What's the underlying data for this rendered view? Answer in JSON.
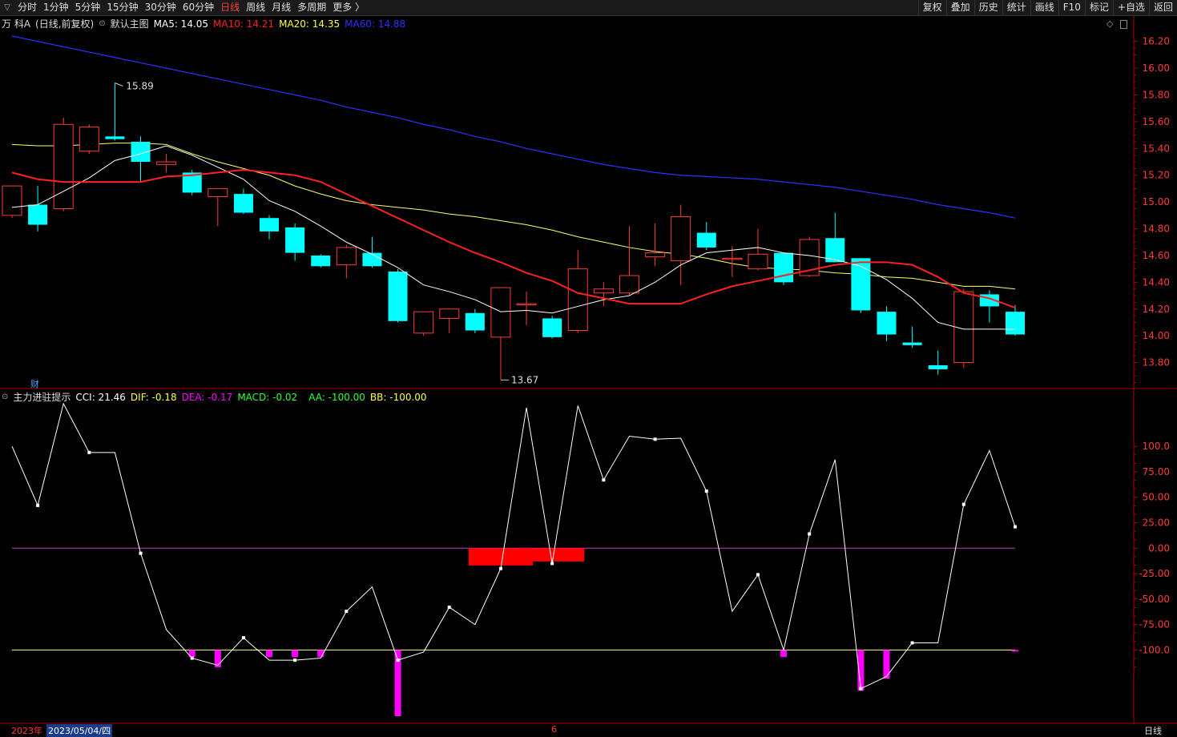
{
  "toolbar": {
    "tabs": [
      "分时",
      "1分钟",
      "5分钟",
      "15分钟",
      "30分钟",
      "60分钟",
      "日线",
      "周线",
      "月线",
      "多周期",
      "更多 〉"
    ],
    "active_tab": "日线",
    "right_buttons": [
      "复权",
      "叠加",
      "历史",
      "统计",
      "画线",
      "F10",
      "标记",
      "+自选",
      "返回"
    ]
  },
  "main": {
    "stock_name": "万 科A",
    "period": "(日线,前复权)",
    "chart_label": "默认主图",
    "ma5": "MA5: 14.05",
    "ma10": "MA10: 14.21",
    "ma20": "MA20: 14.35",
    "ma60": "MA60: 14.88",
    "high_label": "15.89",
    "low_label": "13.67",
    "cai_label": "财",
    "yticks": [
      "16.20",
      "16.00",
      "15.80",
      "15.60",
      "15.40",
      "15.20",
      "15.00",
      "14.80",
      "14.60",
      "14.40",
      "14.20",
      "14.00",
      "13.80"
    ]
  },
  "indicator": {
    "title": "主力进驻提示",
    "cci": "CCI: 21.46",
    "dif": "DIF: -0.18",
    "dea": "DEA: -0.17",
    "macd": "MACD: -0.02",
    "aa": "AA: -100.00",
    "bb": "BB: -100.00",
    "yticks": [
      "100.0",
      "75.00",
      "50.00",
      "25.00",
      "0.00",
      "-25.00",
      "-50.00",
      "-75.00",
      "-100.0"
    ]
  },
  "bottom": {
    "year": "2023年",
    "date": "2023/05/04/四",
    "month_mark": "6",
    "period_label": "日线"
  },
  "colors": {
    "up": "#ff3b3b",
    "down": "#00ffff",
    "ma5": "#ffffff",
    "ma10": "#ff2020",
    "ma20": "#ffff66",
    "ma60": "#3030ff",
    "axis": "#b00000",
    "magenta": "#ff00ff"
  },
  "chart_data": [
    {
      "type": "candlestick",
      "ylim": [
        13.6,
        16.3
      ],
      "candles": [
        {
          "o": 14.9,
          "h": 15.12,
          "l": 14.88,
          "c": 15.12
        },
        {
          "o": 14.98,
          "h": 15.12,
          "l": 14.78,
          "c": 14.83
        },
        {
          "o": 14.95,
          "h": 15.63,
          "l": 14.93,
          "c": 15.58
        },
        {
          "o": 15.38,
          "h": 15.58,
          "l": 15.36,
          "c": 15.56
        },
        {
          "o": 15.49,
          "h": 15.89,
          "l": 15.46,
          "c": 15.47
        },
        {
          "o": 15.45,
          "h": 15.49,
          "l": 15.15,
          "c": 15.3
        },
        {
          "o": 15.28,
          "h": 15.36,
          "l": 15.22,
          "c": 15.3
        },
        {
          "o": 15.22,
          "h": 15.24,
          "l": 15.05,
          "c": 15.07
        },
        {
          "o": 15.04,
          "h": 15.1,
          "l": 14.82,
          "c": 15.1
        },
        {
          "o": 15.06,
          "h": 15.1,
          "l": 14.91,
          "c": 14.92
        },
        {
          "o": 14.88,
          "h": 14.9,
          "l": 14.72,
          "c": 14.78
        },
        {
          "o": 14.81,
          "h": 14.84,
          "l": 14.56,
          "c": 14.62
        },
        {
          "o": 14.6,
          "h": 14.61,
          "l": 14.51,
          "c": 14.52
        },
        {
          "o": 14.53,
          "h": 14.68,
          "l": 14.43,
          "c": 14.66
        },
        {
          "o": 14.62,
          "h": 14.74,
          "l": 14.51,
          "c": 14.52
        },
        {
          "o": 14.48,
          "h": 14.5,
          "l": 14.1,
          "c": 14.11
        },
        {
          "o": 14.02,
          "h": 14.18,
          "l": 14.0,
          "c": 14.18
        },
        {
          "o": 14.13,
          "h": 14.2,
          "l": 14.02,
          "c": 14.2
        },
        {
          "o": 14.17,
          "h": 14.2,
          "l": 14.02,
          "c": 14.04
        },
        {
          "o": 13.99,
          "h": 14.36,
          "l": 13.67,
          "c": 14.36
        },
        {
          "o": 14.24,
          "h": 14.33,
          "l": 14.08,
          "c": 14.24
        },
        {
          "o": 14.13,
          "h": 14.15,
          "l": 13.98,
          "c": 13.99
        },
        {
          "o": 14.04,
          "h": 14.64,
          "l": 14.02,
          "c": 14.5
        },
        {
          "o": 14.32,
          "h": 14.4,
          "l": 14.22,
          "c": 14.35
        },
        {
          "o": 14.32,
          "h": 14.82,
          "l": 14.3,
          "c": 14.45
        },
        {
          "o": 14.59,
          "h": 14.84,
          "l": 14.52,
          "c": 14.62
        },
        {
          "o": 14.56,
          "h": 14.98,
          "l": 14.38,
          "c": 14.89
        },
        {
          "o": 14.77,
          "h": 14.85,
          "l": 14.64,
          "c": 14.66
        },
        {
          "o": 14.58,
          "h": 14.67,
          "l": 14.44,
          "c": 14.58
        },
        {
          "o": 14.5,
          "h": 14.8,
          "l": 14.49,
          "c": 14.61
        },
        {
          "o": 14.62,
          "h": 14.62,
          "l": 14.38,
          "c": 14.4
        },
        {
          "o": 14.45,
          "h": 14.74,
          "l": 14.44,
          "c": 14.72
        },
        {
          "o": 14.73,
          "h": 14.92,
          "l": 14.55,
          "c": 14.55
        },
        {
          "o": 14.58,
          "h": 14.58,
          "l": 14.17,
          "c": 14.19
        },
        {
          "o": 14.18,
          "h": 14.22,
          "l": 13.96,
          "c": 14.01
        },
        {
          "o": 13.95,
          "h": 14.07,
          "l": 13.91,
          "c": 13.93
        },
        {
          "o": 13.78,
          "h": 13.89,
          "l": 13.71,
          "c": 13.75
        },
        {
          "o": 13.8,
          "h": 14.35,
          "l": 13.76,
          "c": 14.33
        },
        {
          "o": 14.31,
          "h": 14.34,
          "l": 14.1,
          "c": 14.22
        },
        {
          "o": 14.18,
          "h": 14.23,
          "l": 14.0,
          "c": 14.01
        }
      ],
      "ma5": [
        14.96,
        14.98,
        15.08,
        15.18,
        15.31,
        15.36,
        15.42,
        15.35,
        15.26,
        15.17,
        15.01,
        14.93,
        14.82,
        14.7,
        14.61,
        14.51,
        14.38,
        14.33,
        14.27,
        14.18,
        14.19,
        14.17,
        14.22,
        14.27,
        14.3,
        14.4,
        14.53,
        14.62,
        14.64,
        14.66,
        14.62,
        14.6,
        14.57,
        14.52,
        14.42,
        14.28,
        14.1,
        14.05,
        14.05,
        14.05
      ],
      "ma10": [
        15.22,
        15.17,
        15.15,
        15.15,
        15.15,
        15.15,
        15.19,
        15.2,
        15.22,
        15.24,
        15.22,
        15.2,
        15.15,
        15.06,
        14.97,
        14.88,
        14.79,
        14.7,
        14.62,
        14.55,
        14.47,
        14.41,
        14.32,
        14.28,
        14.24,
        14.24,
        14.24,
        14.31,
        14.37,
        14.41,
        14.45,
        14.49,
        14.53,
        14.55,
        14.55,
        14.53,
        14.44,
        14.32,
        14.28,
        14.21
      ],
      "ma20": [
        15.43,
        15.42,
        15.42,
        15.43,
        15.44,
        15.44,
        15.43,
        15.36,
        15.3,
        15.25,
        15.2,
        15.12,
        15.06,
        15.01,
        14.98,
        14.96,
        14.94,
        14.91,
        14.89,
        14.86,
        14.83,
        14.79,
        14.74,
        14.7,
        14.66,
        14.63,
        14.61,
        14.58,
        14.54,
        14.51,
        14.5,
        14.49,
        14.47,
        14.46,
        14.44,
        14.43,
        14.4,
        14.37,
        14.37,
        14.35
      ],
      "ma60": [
        16.24,
        16.2,
        16.16,
        16.12,
        16.08,
        16.04,
        16.0,
        15.96,
        15.92,
        15.88,
        15.84,
        15.8,
        15.76,
        15.71,
        15.67,
        15.63,
        15.58,
        15.54,
        15.49,
        15.45,
        15.4,
        15.36,
        15.32,
        15.28,
        15.25,
        15.22,
        15.2,
        15.19,
        15.18,
        15.17,
        15.15,
        15.13,
        15.11,
        15.08,
        15.05,
        15.02,
        14.98,
        14.95,
        14.92,
        14.88
      ]
    },
    {
      "type": "line",
      "ylim": [
        -165,
        145
      ],
      "cci": [
        100,
        42,
        142,
        94,
        94,
        -5,
        -80,
        -108,
        -115,
        -88,
        -110,
        -110,
        -108,
        -62,
        -38,
        -110,
        -102,
        -58,
        -75,
        -20,
        138,
        -15,
        140,
        67,
        110,
        107,
        108,
        56,
        -62,
        -26,
        -100,
        14,
        87,
        -138,
        -126,
        -93,
        -93,
        43,
        96,
        21
      ],
      "aa": [
        null,
        null,
        null,
        null,
        null,
        null,
        null,
        -100,
        -100,
        null,
        -100,
        -100,
        -100,
        null,
        null,
        -100,
        null,
        null,
        null,
        null,
        null,
        null,
        null,
        null,
        null,
        null,
        null,
        null,
        null,
        null,
        -100,
        null,
        null,
        -100,
        -100,
        null,
        null,
        null,
        null,
        -100
      ],
      "bb": [
        null,
        null,
        null,
        null,
        null,
        null,
        null,
        -107,
        -117,
        null,
        -107,
        -107,
        -107,
        null,
        null,
        -165,
        null,
        null,
        null,
        null,
        null,
        null,
        null,
        null,
        null,
        null,
        null,
        null,
        null,
        null,
        -107,
        null,
        null,
        -140,
        -128,
        null,
        null,
        null,
        null,
        -100
      ],
      "red_blocks": [
        {
          "x0": 18,
          "x1": 20,
          "y0": 0,
          "y1": -17
        },
        {
          "x0": 20,
          "x1": 22,
          "y0": 0,
          "y1": -13
        }
      ],
      "hlines": [
        0,
        -100
      ]
    }
  ]
}
